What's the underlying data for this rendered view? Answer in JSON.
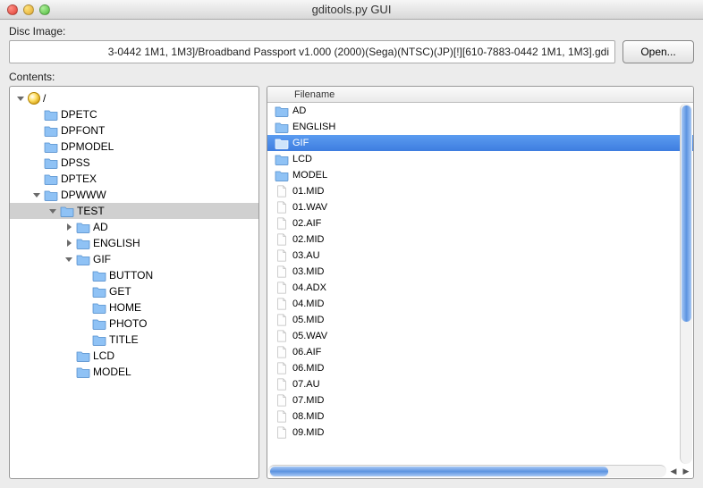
{
  "window": {
    "title": "gditools.py GUI"
  },
  "disc_image": {
    "label": "Disc Image:",
    "path": "3-0442 1M1, 1M3]/Broadband Passport v1.000 (2000)(Sega)(NTSC)(JP)[!][610-7883-0442 1M1, 1M3].gdi",
    "open_button": "Open..."
  },
  "contents_label": "Contents:",
  "tree": {
    "root_label": "/",
    "nodes": [
      {
        "label": "DPETC",
        "depth": 1,
        "kind": "folder",
        "expandable": false
      },
      {
        "label": "DPFONT",
        "depth": 1,
        "kind": "folder",
        "expandable": false
      },
      {
        "label": "DPMODEL",
        "depth": 1,
        "kind": "folder",
        "expandable": false
      },
      {
        "label": "DPSS",
        "depth": 1,
        "kind": "folder",
        "expandable": false
      },
      {
        "label": "DPTEX",
        "depth": 1,
        "kind": "folder",
        "expandable": false
      },
      {
        "label": "DPWWW",
        "depth": 1,
        "kind": "folder",
        "expandable": true,
        "expanded": true
      },
      {
        "label": "TEST",
        "depth": 2,
        "kind": "folder",
        "expandable": true,
        "expanded": true,
        "selected": true
      },
      {
        "label": "AD",
        "depth": 3,
        "kind": "folder",
        "expandable": true,
        "expanded": false
      },
      {
        "label": "ENGLISH",
        "depth": 3,
        "kind": "folder",
        "expandable": true,
        "expanded": false
      },
      {
        "label": "GIF",
        "depth": 3,
        "kind": "folder",
        "expandable": true,
        "expanded": true
      },
      {
        "label": "BUTTON",
        "depth": 4,
        "kind": "folder",
        "expandable": false
      },
      {
        "label": "GET",
        "depth": 4,
        "kind": "folder",
        "expandable": false
      },
      {
        "label": "HOME",
        "depth": 4,
        "kind": "folder",
        "expandable": false
      },
      {
        "label": "PHOTO",
        "depth": 4,
        "kind": "folder",
        "expandable": false
      },
      {
        "label": "TITLE",
        "depth": 4,
        "kind": "folder",
        "expandable": false
      },
      {
        "label": "LCD",
        "depth": 3,
        "kind": "folder",
        "expandable": false
      },
      {
        "label": "MODEL",
        "depth": 3,
        "kind": "folder",
        "expandable": false
      }
    ]
  },
  "list": {
    "header": "Filename",
    "rows": [
      {
        "name": "AD",
        "kind": "folder",
        "selected": false
      },
      {
        "name": "ENGLISH",
        "kind": "folder",
        "selected": false
      },
      {
        "name": "GIF",
        "kind": "folder",
        "selected": true
      },
      {
        "name": "LCD",
        "kind": "folder",
        "selected": false
      },
      {
        "name": "MODEL",
        "kind": "folder",
        "selected": false
      },
      {
        "name": "01.MID",
        "kind": "file",
        "selected": false
      },
      {
        "name": "01.WAV",
        "kind": "file",
        "selected": false
      },
      {
        "name": "02.AIF",
        "kind": "file",
        "selected": false
      },
      {
        "name": "02.MID",
        "kind": "file",
        "selected": false
      },
      {
        "name": "03.AU",
        "kind": "file",
        "selected": false
      },
      {
        "name": "03.MID",
        "kind": "file",
        "selected": false
      },
      {
        "name": "04.ADX",
        "kind": "file",
        "selected": false
      },
      {
        "name": "04.MID",
        "kind": "file",
        "selected": false
      },
      {
        "name": "05.MID",
        "kind": "file",
        "selected": false
      },
      {
        "name": "05.WAV",
        "kind": "file",
        "selected": false
      },
      {
        "name": "06.AIF",
        "kind": "file",
        "selected": false
      },
      {
        "name": "06.MID",
        "kind": "file",
        "selected": false
      },
      {
        "name": "07.AU",
        "kind": "file",
        "selected": false
      },
      {
        "name": "07.MID",
        "kind": "file",
        "selected": false
      },
      {
        "name": "08.MID",
        "kind": "file",
        "selected": false
      },
      {
        "name": "09.MID",
        "kind": "file",
        "selected": false
      }
    ]
  }
}
